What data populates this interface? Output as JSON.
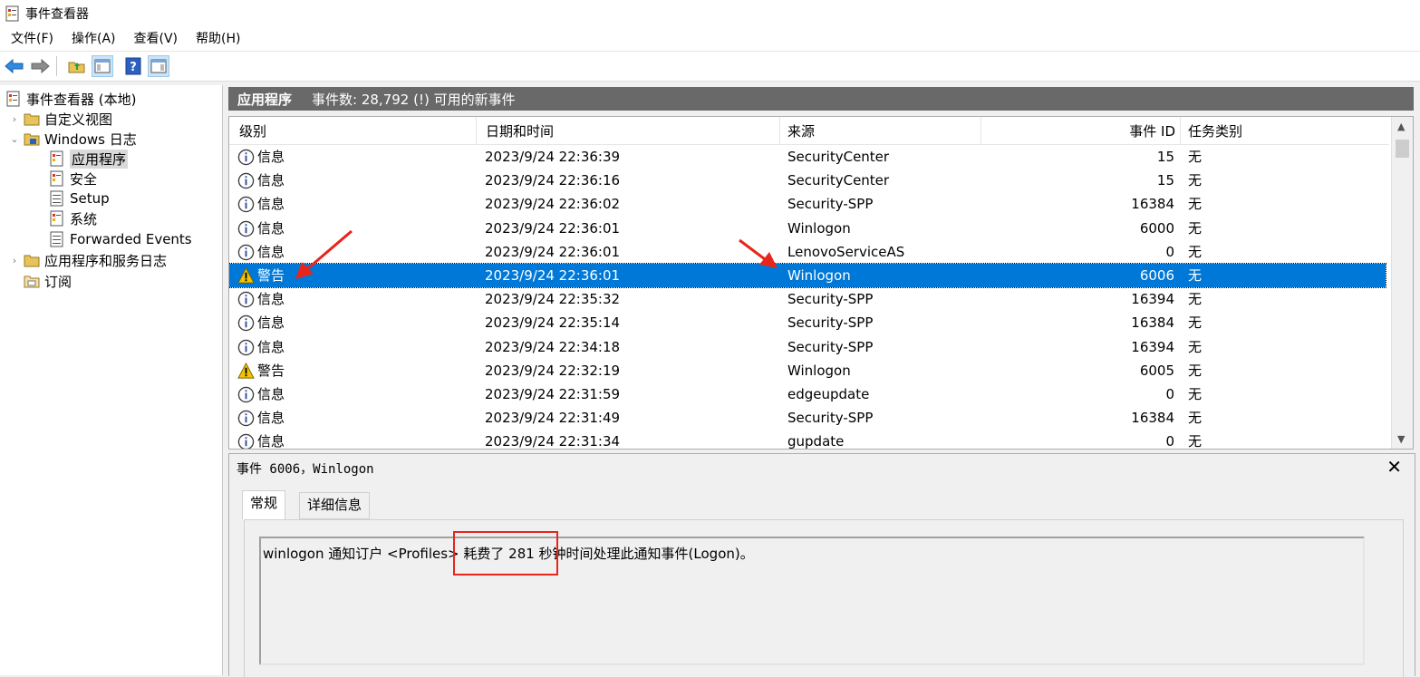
{
  "window": {
    "title": "事件查看器"
  },
  "menu": [
    "文件(F)",
    "操作(A)",
    "查看(V)",
    "帮助(H)"
  ],
  "toolbar": {
    "icons": [
      "back-arrow-icon",
      "forward-arrow-icon",
      "folder-up-icon",
      "console-tree-icon",
      "help-icon",
      "action-pane-icon"
    ]
  },
  "tree": {
    "root": "事件查看器 (本地)",
    "custom_views": "自定义视图",
    "windows_logs": "Windows 日志",
    "application": "应用程序",
    "security": "安全",
    "setup": "Setup",
    "system": "系统",
    "forwarded": "Forwarded Events",
    "app_service_logs": "应用程序和服务日志",
    "subscriptions": "订阅"
  },
  "list": {
    "title": "应用程序",
    "count_text": "事件数: 28,792 (!) 可用的新事件",
    "columns": [
      "级别",
      "日期和时间",
      "来源",
      "事件 ID",
      "任务类别"
    ],
    "rows": [
      {
        "level": "信息",
        "icon": "info-icon",
        "datetime": "2023/9/24 22:36:39",
        "source": "SecurityCenter",
        "id": "15",
        "task": "无"
      },
      {
        "level": "信息",
        "icon": "info-icon",
        "datetime": "2023/9/24 22:36:16",
        "source": "SecurityCenter",
        "id": "15",
        "task": "无"
      },
      {
        "level": "信息",
        "icon": "info-icon",
        "datetime": "2023/9/24 22:36:02",
        "source": "Security-SPP",
        "id": "16384",
        "task": "无"
      },
      {
        "level": "信息",
        "icon": "info-icon",
        "datetime": "2023/9/24 22:36:01",
        "source": "Winlogon",
        "id": "6000",
        "task": "无"
      },
      {
        "level": "信息",
        "icon": "info-icon",
        "datetime": "2023/9/24 22:36:01",
        "source": "LenovoServiceAS",
        "id": "0",
        "task": "无"
      },
      {
        "level": "警告",
        "icon": "warning-icon",
        "datetime": "2023/9/24 22:36:01",
        "source": "Winlogon",
        "id": "6006",
        "task": "无",
        "selected": true
      },
      {
        "level": "信息",
        "icon": "info-icon",
        "datetime": "2023/9/24 22:35:32",
        "source": "Security-SPP",
        "id": "16394",
        "task": "无"
      },
      {
        "level": "信息",
        "icon": "info-icon",
        "datetime": "2023/9/24 22:35:14",
        "source": "Security-SPP",
        "id": "16384",
        "task": "无"
      },
      {
        "level": "信息",
        "icon": "info-icon",
        "datetime": "2023/9/24 22:34:18",
        "source": "Security-SPP",
        "id": "16394",
        "task": "无"
      },
      {
        "level": "警告",
        "icon": "warning-icon",
        "datetime": "2023/9/24 22:32:19",
        "source": "Winlogon",
        "id": "6005",
        "task": "无"
      },
      {
        "level": "信息",
        "icon": "info-icon",
        "datetime": "2023/9/24 22:31:59",
        "source": "edgeupdate",
        "id": "0",
        "task": "无"
      },
      {
        "level": "信息",
        "icon": "info-icon",
        "datetime": "2023/9/24 22:31:49",
        "source": "Security-SPP",
        "id": "16384",
        "task": "无"
      },
      {
        "level": "信息",
        "icon": "info-icon",
        "datetime": "2023/9/24 22:31:34",
        "source": "gupdate",
        "id": "0",
        "task": "无"
      }
    ]
  },
  "detail": {
    "title": "事件 6006，Winlogon",
    "tabs": [
      "常规",
      "详细信息"
    ],
    "message": "winlogon 通知订户 <Profiles> 耗费了 281 秒钟时间处理此通知事件(Logon)。"
  },
  "colors": {
    "selection": "#0078d7",
    "header_bar": "#696969",
    "annotation": "#e8251b"
  }
}
